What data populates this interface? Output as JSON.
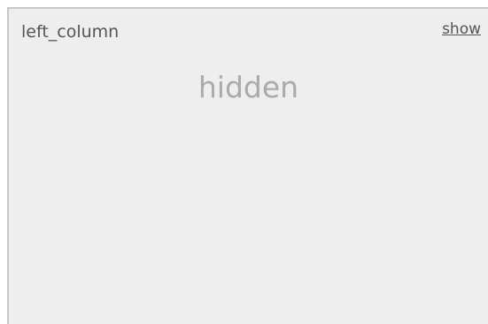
{
  "panel": {
    "title": "left_column",
    "show_label": "show",
    "state_text": "hidden"
  },
  "colors": {
    "panel_background": "#eeeeee",
    "panel_border": "#c8c8c8",
    "title_text": "#555555",
    "placeholder_text": "#aaaaaa"
  }
}
